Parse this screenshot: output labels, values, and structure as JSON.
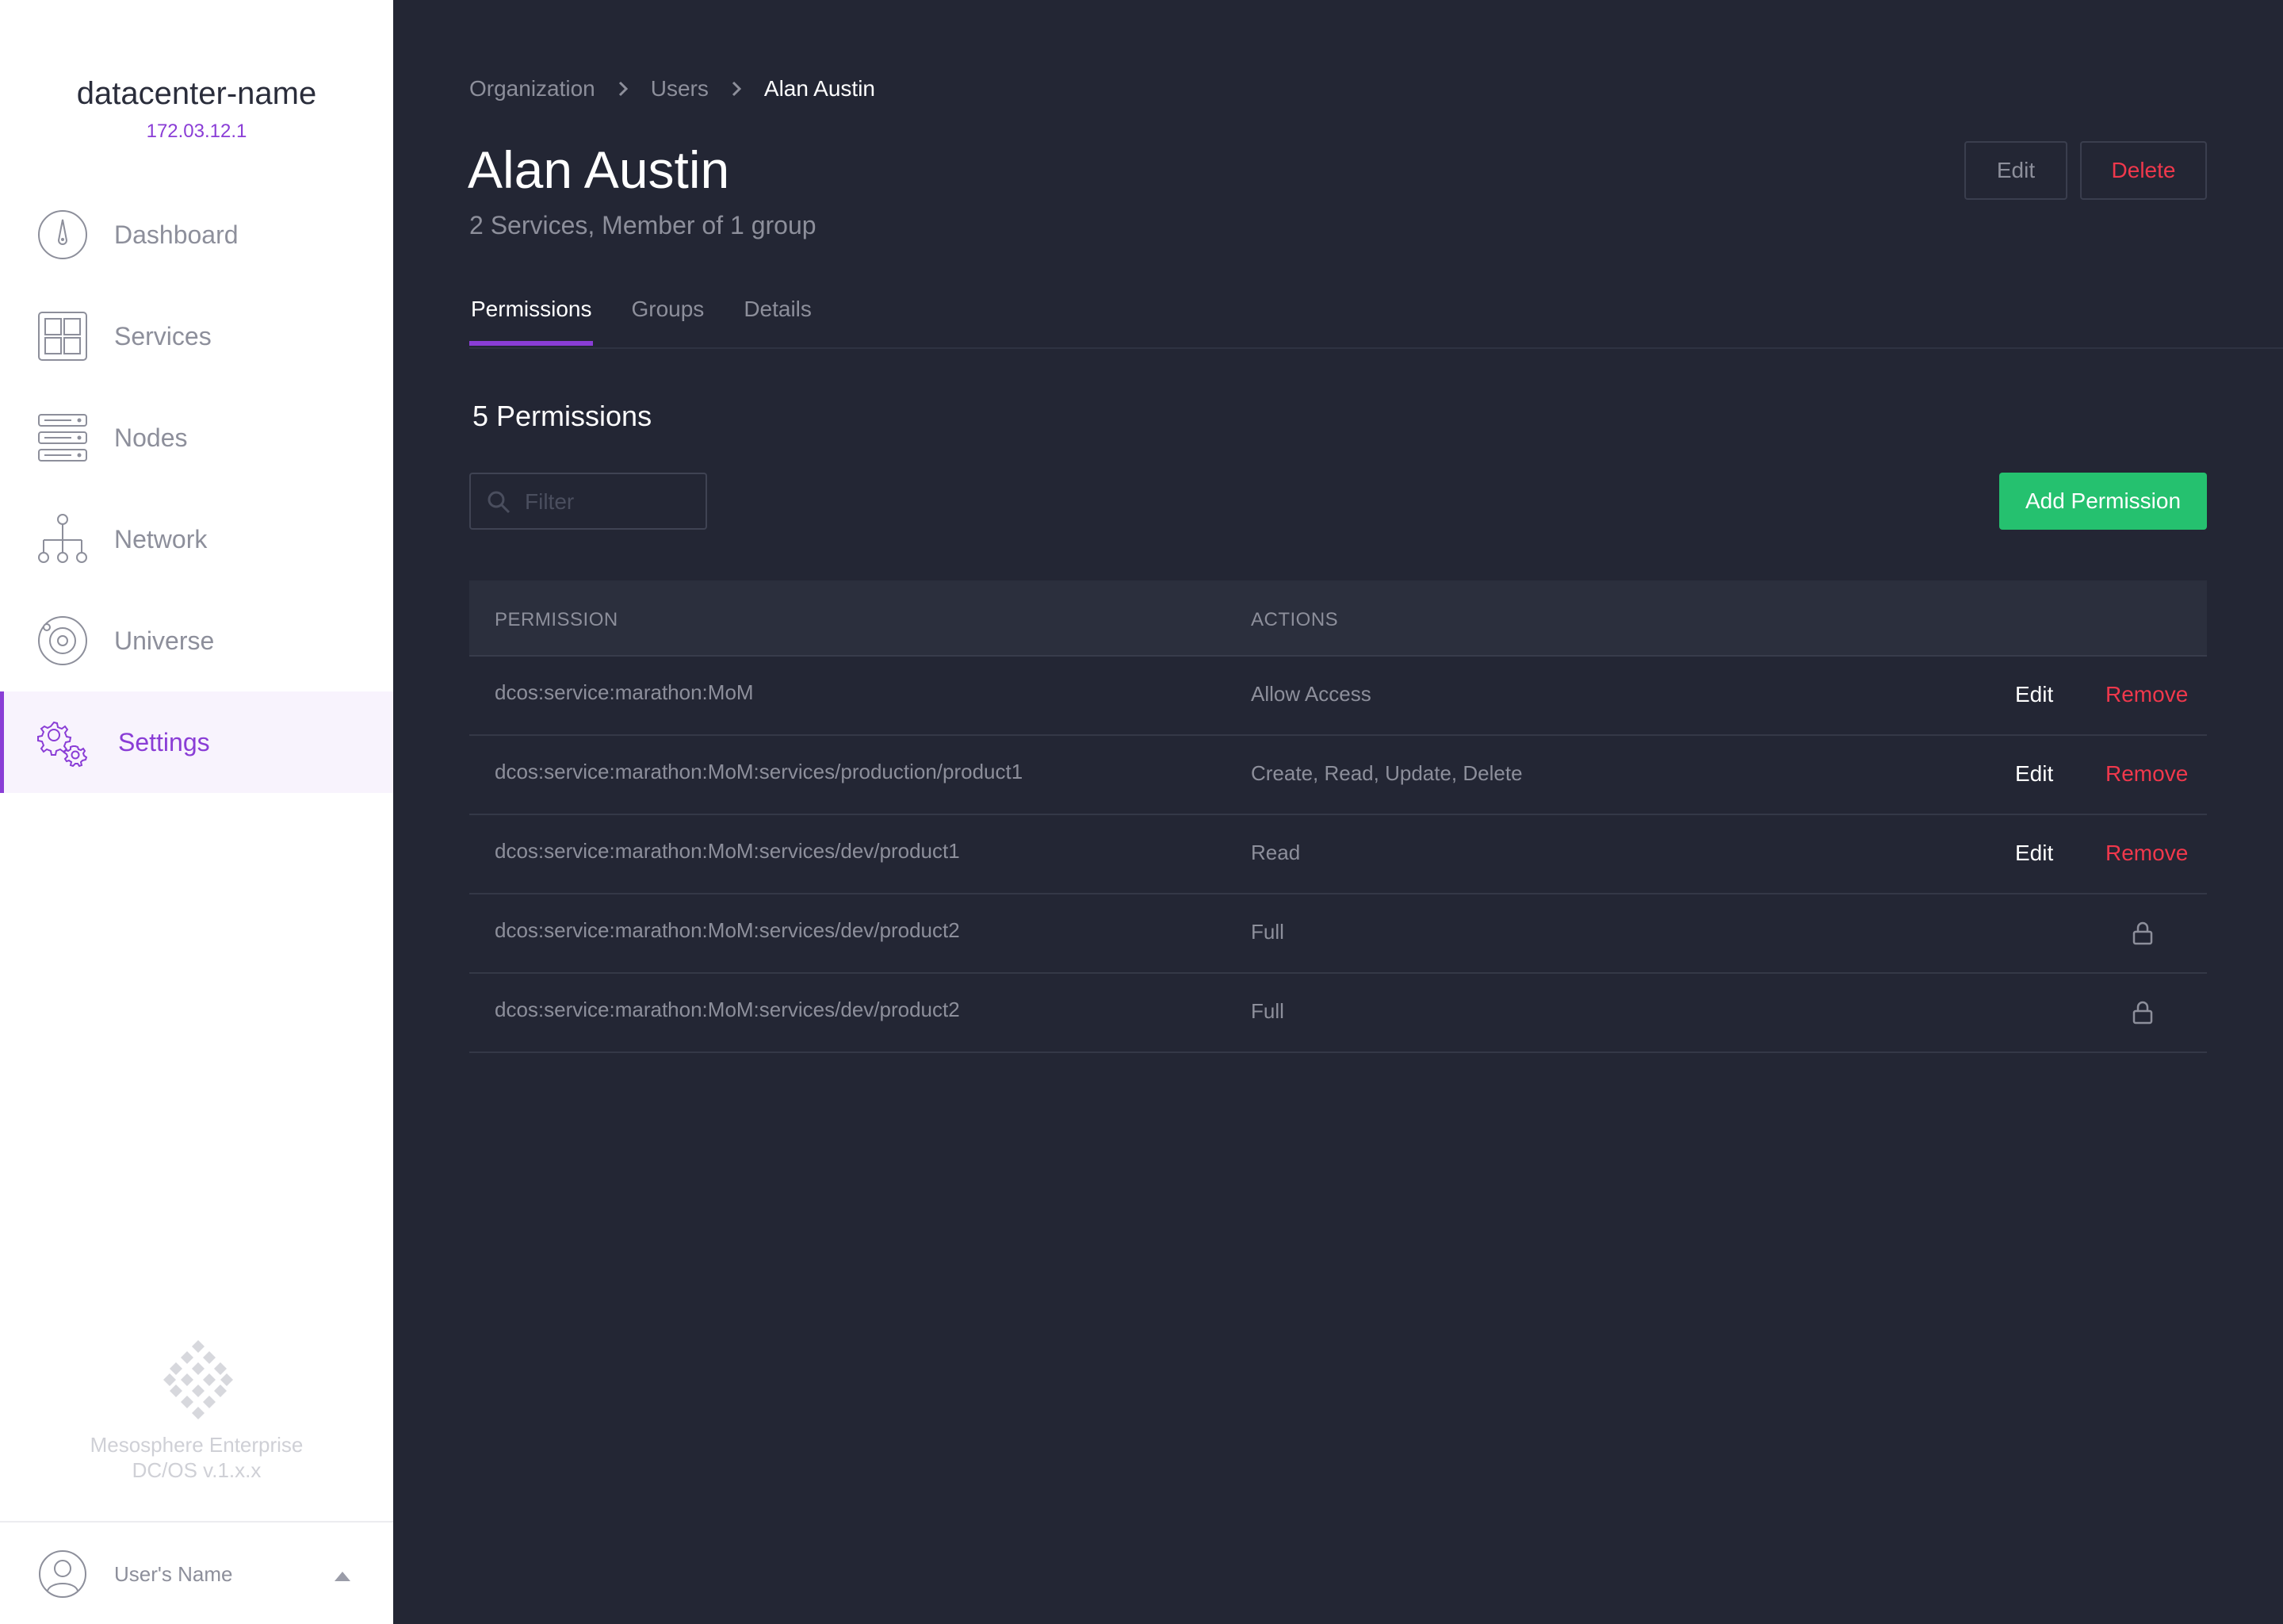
{
  "sidebar": {
    "datacenter_name": "datacenter-name",
    "datacenter_ip": "172.03.12.1",
    "items": [
      {
        "label": "Dashboard",
        "icon": "dashboard-icon"
      },
      {
        "label": "Services",
        "icon": "services-icon"
      },
      {
        "label": "Nodes",
        "icon": "nodes-icon"
      },
      {
        "label": "Network",
        "icon": "network-icon"
      },
      {
        "label": "Universe",
        "icon": "universe-icon"
      },
      {
        "label": "Settings",
        "icon": "settings-icon",
        "active": true
      }
    ],
    "brand_line1": "Mesosphere Enterprise",
    "brand_line2": "DC/OS v.1.x.x",
    "user_name": "User's Name"
  },
  "breadcrumb": [
    "Organization",
    "Users",
    "Alan Austin"
  ],
  "header": {
    "title": "Alan Austin",
    "subtitle": "2 Services, Member of 1 group",
    "edit_label": "Edit",
    "delete_label": "Delete"
  },
  "tabs": [
    {
      "label": "Permissions",
      "active": true
    },
    {
      "label": "Groups"
    },
    {
      "label": "Details"
    }
  ],
  "permissions": {
    "heading": "5 Permissions",
    "filter_placeholder": "Filter",
    "add_label": "Add Permission",
    "columns": [
      "PERMISSION",
      "ACTIONS"
    ],
    "rows": [
      {
        "permission": "dcos:service:marathon:MoM",
        "actions": "Allow Access",
        "edit": "Edit",
        "remove": "Remove"
      },
      {
        "permission": "dcos:service:marathon:MoM:services/production/product1",
        "actions": "Create, Read, Update, Delete",
        "edit": "Edit",
        "remove": "Remove"
      },
      {
        "permission": "dcos:service:marathon:MoM:services/dev/product1",
        "actions": "Read",
        "edit": "Edit",
        "remove": "Remove"
      },
      {
        "permission": "dcos:service:marathon:MoM:services/dev/product2",
        "actions": "Full",
        "locked": true
      },
      {
        "permission": "dcos:service:marathon:MoM:services/dev/product2",
        "actions": "Full",
        "locked": true
      }
    ]
  },
  "colors": {
    "accent": "#8a3dd6",
    "background": "#232634",
    "success": "#25c16f",
    "danger": "#f0384c"
  }
}
